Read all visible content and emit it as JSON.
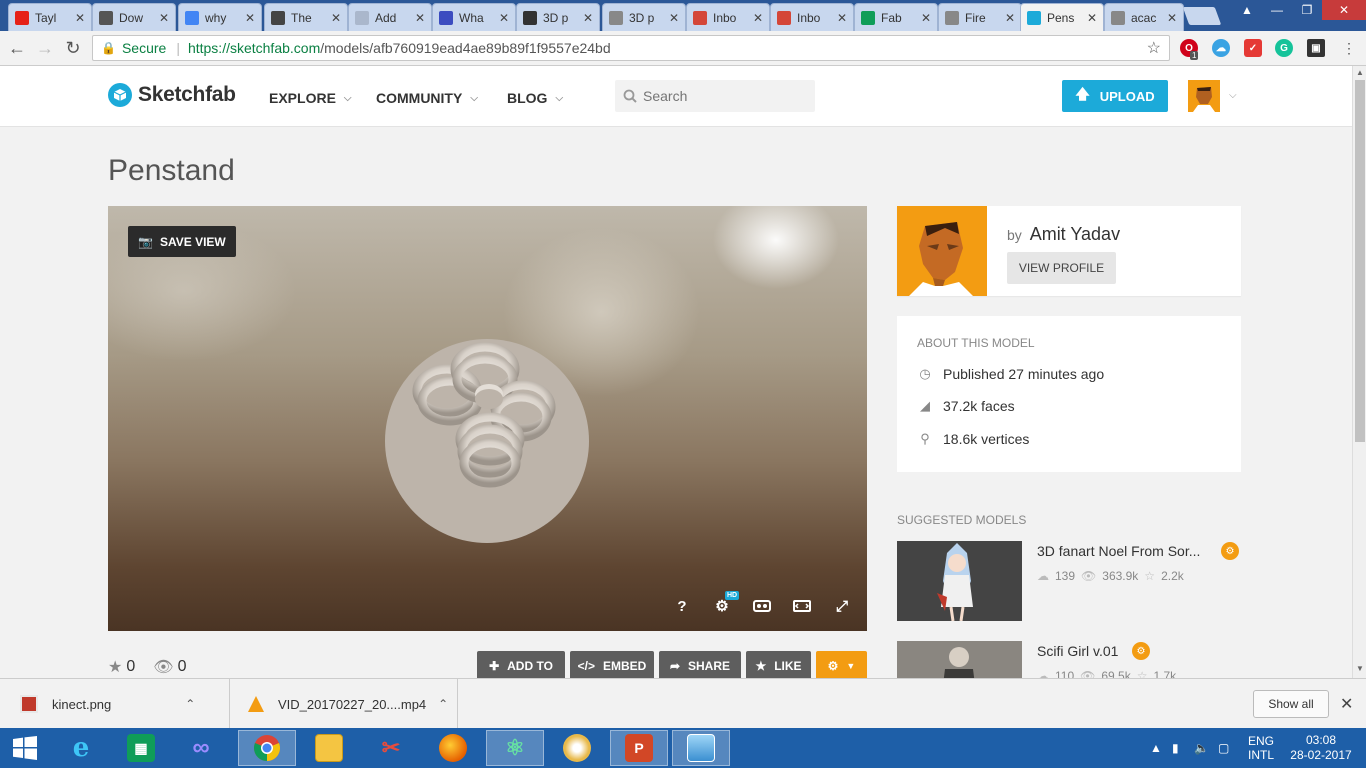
{
  "browser": {
    "tabs": [
      {
        "label": "Tayl",
        "favicon": "youtube-icon",
        "color": "#e62117"
      },
      {
        "label": "Dow",
        "favicon": "download-icon",
        "color": "#555555"
      },
      {
        "label": "why",
        "favicon": "google-icon",
        "color": "#4285f4"
      },
      {
        "label": "The",
        "favicon": "globe-icon",
        "color": "#444444"
      },
      {
        "label": "Add",
        "favicon": "page-icon",
        "color": "#aab7cc"
      },
      {
        "label": "Wha",
        "favicon": "cube-icon",
        "color": "#3b4cc0"
      },
      {
        "label": "3D p",
        "favicon": "wikipedia-icon",
        "color": "#333333"
      },
      {
        "label": "3D p",
        "favicon": "page-icon",
        "color": "#888888"
      },
      {
        "label": "Inbo",
        "favicon": "gmail-icon",
        "color": "#d44638"
      },
      {
        "label": "Inbo",
        "favicon": "gmail-icon",
        "color": "#d44638"
      },
      {
        "label": "Fab",
        "favicon": "drive-icon",
        "color": "#0f9d58"
      },
      {
        "label": "Fire",
        "favicon": "page-icon",
        "color": "#888888"
      },
      {
        "label": "Pens",
        "favicon": "sketchfab-icon",
        "color": "#1caad9",
        "active": true
      },
      {
        "label": "acac",
        "favicon": "page-icon",
        "color": "#888888"
      }
    ],
    "secure_label": "Secure",
    "url_host": "https://sketchfab.com",
    "url_path": "/models/afb760919ead4ae89b89f1f9557e24bd",
    "ext_badge": "1"
  },
  "site": {
    "logo": "Sketchfab",
    "nav": [
      "EXPLORE",
      "COMMUNITY",
      "BLOG"
    ],
    "search_placeholder": "Search",
    "upload_label": "UPLOAD"
  },
  "model": {
    "title": "Penstand",
    "save_view": "SAVE VIEW",
    "hd_badge": "HD",
    "help": "?",
    "likes": "0",
    "views": "0",
    "actions": [
      "ADD TO",
      "EMBED",
      "SHARE",
      "LIKE"
    ]
  },
  "author": {
    "by": "by",
    "name": "Amit Yadav",
    "view_profile": "VIEW PROFILE"
  },
  "about": {
    "heading": "ABOUT THIS MODEL",
    "published": "Published 27 minutes ago",
    "faces_value": "37.2k",
    "faces_label": " faces",
    "vertices_value": "18.6k",
    "vertices_label": " vertices"
  },
  "suggested": {
    "heading": "SUGGESTED MODELS",
    "items": [
      {
        "title": "3D fanart Noel From Sor...",
        "comments": "139",
        "views": "363.9k",
        "likes": "2.2k"
      },
      {
        "title": "Scifi Girl v.01",
        "comments": "110",
        "views": "69.5k",
        "likes": "1.7k"
      }
    ]
  },
  "downloads": {
    "items": [
      {
        "name": "kinect.png"
      },
      {
        "name": "VID_20170227_20....mp4"
      }
    ],
    "show_all": "Show all"
  },
  "taskbar": {
    "lang1": "ENG",
    "lang2": "INTL",
    "time": "03:08",
    "date": "28-02-2017"
  }
}
